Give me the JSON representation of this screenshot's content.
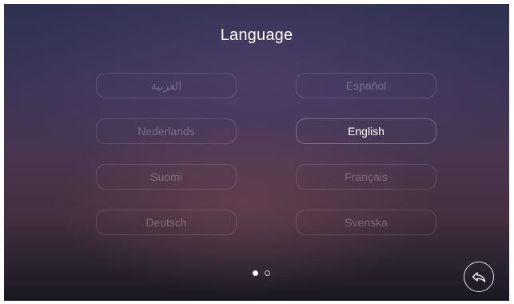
{
  "header": {
    "title": "Language"
  },
  "languages": [
    {
      "label": "العربية",
      "selected": false
    },
    {
      "label": "Español",
      "selected": false
    },
    {
      "label": "Nederlands",
      "selected": false
    },
    {
      "label": "English",
      "selected": true
    },
    {
      "label": "Suomi",
      "selected": false
    },
    {
      "label": "Français",
      "selected": false
    },
    {
      "label": "Deutsch",
      "selected": false
    },
    {
      "label": "Svenska",
      "selected": false
    }
  ],
  "pager": {
    "current_page": 1,
    "total_pages": 2
  },
  "back": {
    "icon": "back-arrow-icon"
  },
  "colors": {
    "text_primary": "#ffffff",
    "text_dim": "rgba(255,255,255,0.26)"
  }
}
